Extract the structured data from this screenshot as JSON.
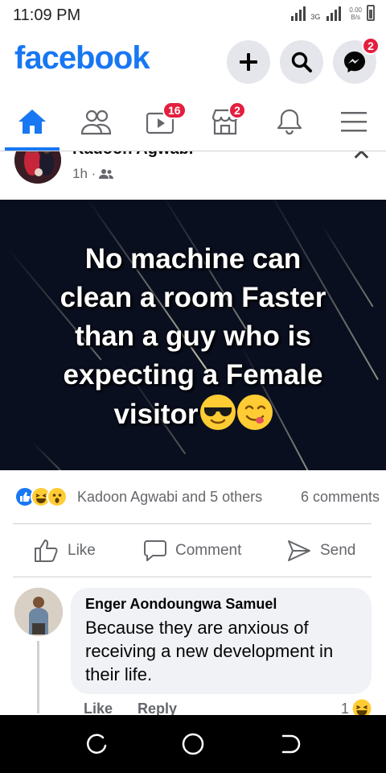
{
  "status_bar": {
    "time": "11:09 PM",
    "network": "3G",
    "speed_value": "0.00",
    "speed_unit": "B/s"
  },
  "header": {
    "logo": "facebook",
    "messenger_badge": "2"
  },
  "nav": {
    "items": [
      {
        "name": "home",
        "icon": "home-icon"
      },
      {
        "name": "friends",
        "icon": "friends-icon"
      },
      {
        "name": "watch",
        "icon": "video-icon",
        "badge": "16"
      },
      {
        "name": "marketplace",
        "icon": "marketplace-icon",
        "badge": "2"
      },
      {
        "name": "notifications",
        "icon": "bell-icon"
      },
      {
        "name": "menu",
        "icon": "menu-icon"
      }
    ]
  },
  "post": {
    "author": "Kadoon Agwabi",
    "time": "1h ·",
    "caption_lines": [
      "No machine can",
      "clean a room Faster",
      "than a guy who is",
      "expecting a Female",
      "visitor"
    ],
    "reactions_text": "Kadoon Agwabi and 5 others",
    "comments_count": "6 comments",
    "actions": {
      "like": "Like",
      "comment": "Comment",
      "send": "Send"
    }
  },
  "comment": {
    "author": "Enger Aondoungwa Samuel",
    "text": "Because they are anxious of receiving a new development in their life.",
    "like": "Like",
    "reply": "Reply",
    "reaction_count": "1"
  },
  "colors": {
    "brand": "#1877f2",
    "badge": "#e41e3f",
    "secondary_text": "#65676b",
    "image_bg": "#0a0f1f"
  }
}
